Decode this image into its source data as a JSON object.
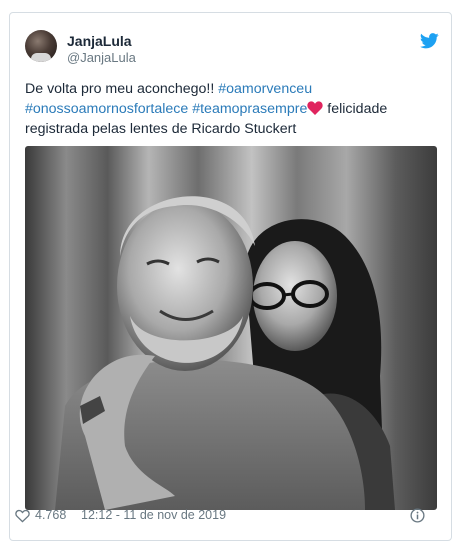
{
  "tweet": {
    "display_name": "JanjaLula",
    "handle": "@JanjaLula",
    "text_line1_plain": "De volta pro meu aconchego!! ",
    "hashtag1": "#oamorvenceu",
    "hashtag2": "#onossoamornosfortalece",
    "hashtag3": "#teamoprasempre",
    "text_after_heart": " felicidade",
    "text_line3": "registrada pelas lentes de Ricardo Stuckert",
    "likes": "4.768",
    "timestamp": "12:12 - 11 de nov de 2019"
  },
  "colors": {
    "hashtag": "#2b7bb9",
    "twitter_blue": "#1da1f2",
    "heart_red": "#e0245e",
    "muted": "#697882"
  },
  "icons": {
    "brand": "twitter-bird-icon",
    "like": "heart-outline-icon",
    "info": "info-icon",
    "emoji": "red-heart-emoji"
  }
}
